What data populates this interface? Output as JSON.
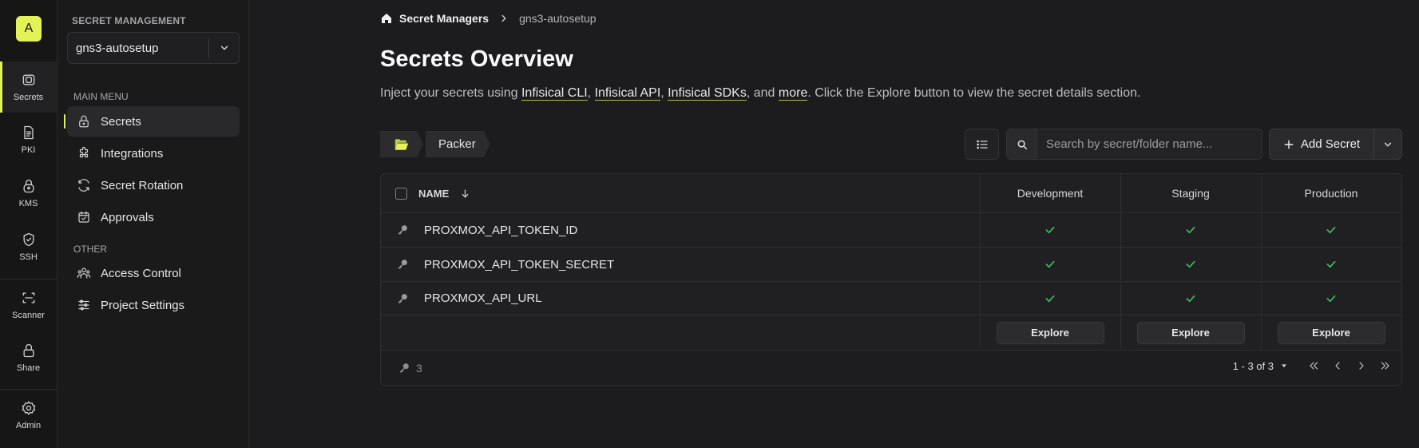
{
  "rail": {
    "logo_letter": "A",
    "items": [
      {
        "label": "Secrets",
        "icon": "vault-icon"
      },
      {
        "label": "PKI",
        "icon": "document-icon"
      },
      {
        "label": "KMS",
        "icon": "lock-key-icon"
      },
      {
        "label": "SSH",
        "icon": "shield-check-icon"
      },
      {
        "label": "Scanner",
        "icon": "scan-icon"
      },
      {
        "label": "Share",
        "icon": "lock-icon"
      },
      {
        "label": "Admin",
        "icon": "gear-icon"
      }
    ]
  },
  "nav": {
    "section_label": "SECRET MANAGEMENT",
    "project": "gns3-autosetup",
    "main_menu_label": "MAIN MENU",
    "main_items": [
      {
        "label": "Secrets",
        "icon": "lock-icon"
      },
      {
        "label": "Integrations",
        "icon": "puzzle-icon"
      },
      {
        "label": "Secret Rotation",
        "icon": "rotate-icon"
      },
      {
        "label": "Approvals",
        "icon": "calendar-check-icon"
      }
    ],
    "other_label": "OTHER",
    "other_items": [
      {
        "label": "Access Control",
        "icon": "users-icon"
      },
      {
        "label": "Project Settings",
        "icon": "sliders-icon"
      }
    ]
  },
  "breadcrumb": {
    "root": "Secret Managers",
    "current": "gns3-autosetup"
  },
  "page": {
    "title": "Secrets Overview",
    "desc_prefix": "Inject your secrets using ",
    "link_cli": "Infisical CLI",
    "sep1": ", ",
    "link_api": "Infisical API",
    "sep2": ", ",
    "link_sdks": "Infisical SDKs",
    "sep3": ", and ",
    "link_more": "more",
    "desc_suffix": ". Click the Explore button to view the secret details section."
  },
  "toolbar": {
    "folder": "Packer",
    "search_placeholder": "Search by secret/folder name...",
    "add_label": "Add Secret"
  },
  "table": {
    "name_header": "NAME",
    "environments": [
      "Development",
      "Staging",
      "Production"
    ],
    "rows": [
      {
        "name": "PROXMOX_API_TOKEN_ID",
        "present": [
          true,
          true,
          true
        ]
      },
      {
        "name": "PROXMOX_API_TOKEN_SECRET",
        "present": [
          true,
          true,
          true
        ]
      },
      {
        "name": "PROXMOX_API_URL",
        "present": [
          true,
          true,
          true
        ]
      }
    ],
    "explore_label": "Explore",
    "count": "3",
    "pagination": "1 - 3 of 3"
  },
  "colors": {
    "accent": "#e4f25a",
    "check": "#3fbf5f",
    "background": "#1c1c1e"
  }
}
